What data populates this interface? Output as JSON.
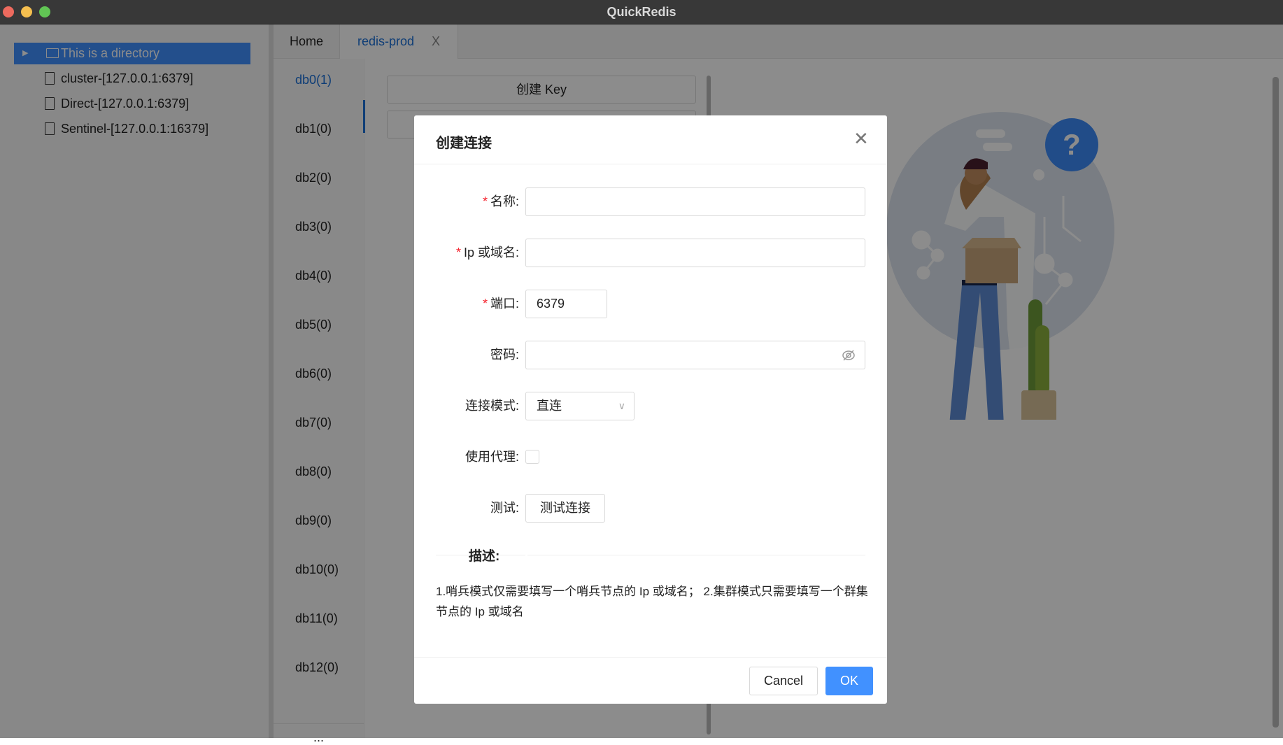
{
  "window": {
    "title": "QuickRedis"
  },
  "sidebar": {
    "items": [
      {
        "label": "This is a directory",
        "type": "folder",
        "selected": true
      },
      {
        "label": "cluster-[127.0.0.1:6379]",
        "type": "file"
      },
      {
        "label": "Direct-[127.0.0.1:6379]",
        "type": "file"
      },
      {
        "label": "Sentinel-[127.0.0.1:16379]",
        "type": "file"
      }
    ]
  },
  "tabs": [
    {
      "label": "Home"
    },
    {
      "label": "redis-prod",
      "active": true,
      "close": "X"
    }
  ],
  "databases": [
    "db0(1)",
    "db1(0)",
    "db2(0)",
    "db3(0)",
    "db4(0)",
    "db5(0)",
    "db6(0)",
    "db7(0)",
    "db8(0)",
    "db9(0)",
    "db10(0)",
    "db11(0)",
    "db12(0)"
  ],
  "db_more": "...",
  "create_key_label": "创建 Key",
  "dialog": {
    "title": "创建连接",
    "fields": {
      "name": {
        "label": "名称:",
        "value": "",
        "required": true
      },
      "host": {
        "label": "Ip 或域名:",
        "value": "",
        "required": true
      },
      "port": {
        "label": "端口:",
        "value": "6379",
        "required": true
      },
      "password": {
        "label": "密码:",
        "value": ""
      },
      "mode": {
        "label": "连接模式:",
        "value": "直连"
      },
      "proxy": {
        "label": "使用代理:",
        "checked": false
      },
      "test": {
        "label": "测试:",
        "button": "测试连接"
      }
    },
    "required_mark": "*",
    "desc_title": "描述:",
    "desc_text": "1.哨兵模式仅需要填写一个哨兵节点的 Ip 或域名； 2.集群模式只需要填写一个群集节点的 Ip 或域名",
    "cancel": "Cancel",
    "ok": "OK"
  },
  "colors": {
    "accent": "#4191ff",
    "ok_button": "#4191ff",
    "required": "#f5222d"
  }
}
